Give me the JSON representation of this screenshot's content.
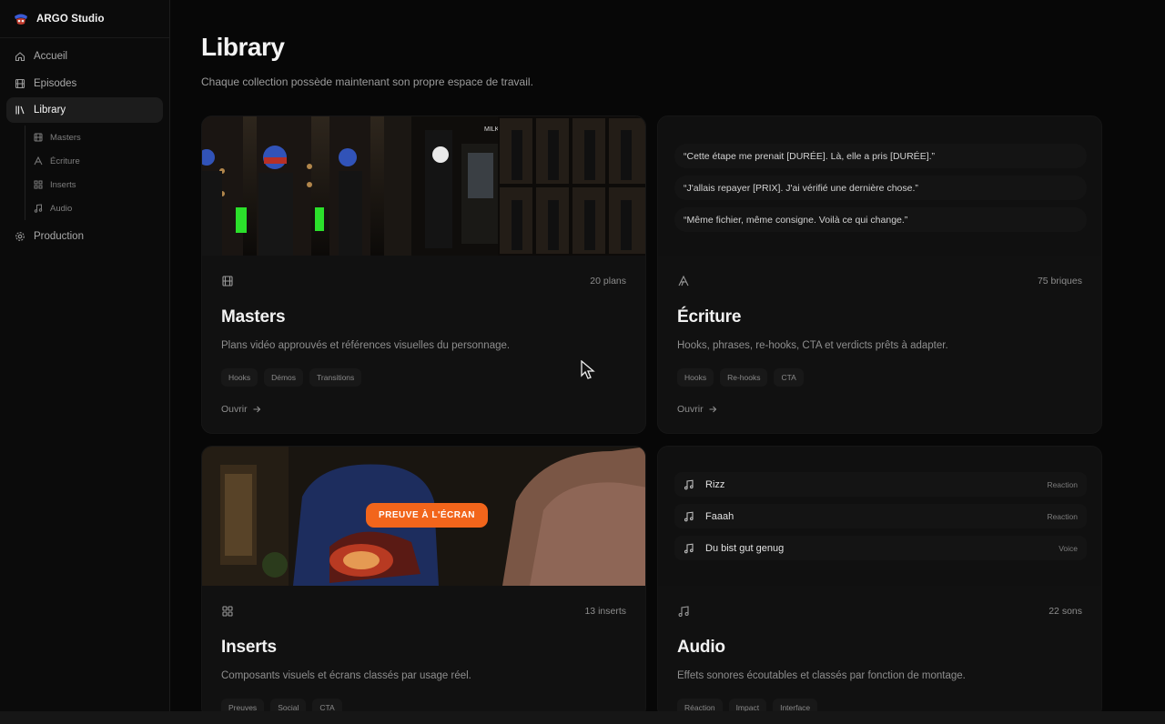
{
  "app": {
    "name": "ARGO Studio"
  },
  "sidebar": {
    "items": [
      {
        "label": "Accueil",
        "icon": "home-icon"
      },
      {
        "label": "Episodes",
        "icon": "film-icon"
      },
      {
        "label": "Library",
        "icon": "library-icon",
        "active": true
      },
      {
        "label": "Production",
        "icon": "gear-icon"
      }
    ],
    "sub_items": [
      {
        "label": "Masters",
        "icon": "film-icon"
      },
      {
        "label": "Écriture",
        "icon": "text-icon"
      },
      {
        "label": "Inserts",
        "icon": "grid-icon"
      },
      {
        "label": "Audio",
        "icon": "music-icon"
      }
    ]
  },
  "page": {
    "title": "Library",
    "subtitle": "Chaque collection possède maintenant son propre espace de travail."
  },
  "cards": {
    "masters": {
      "count": "20 plans",
      "title": "Masters",
      "description": "Plans vidéo approuvés et références visuelles du personnage.",
      "tags": [
        "Hooks",
        "Démos",
        "Transitions"
      ],
      "open": "Ouvrir"
    },
    "ecriture": {
      "quotes": [
        "“Cette étape me prenait [DURÉE]. Là, elle a pris [DURÉE].”",
        "“J'allais repayer [PRIX]. J'ai vérifié une dernière chose.”",
        "“Même fichier, même consigne. Voilà ce qui change.”"
      ],
      "count": "75 briques",
      "title": "Écriture",
      "description": "Hooks, phrases, re-hooks, CTA et verdicts prêts à adapter.",
      "tags": [
        "Hooks",
        "Re-hooks",
        "CTA"
      ],
      "open": "Ouvrir"
    },
    "inserts": {
      "badge": "PREUVE À L'ÉCRAN",
      "count": "13 inserts",
      "title": "Inserts",
      "description": "Composants visuels et écrans classés par usage réel.",
      "tags": [
        "Preuves",
        "Social",
        "CTA"
      ]
    },
    "audio": {
      "tracks": [
        {
          "name": "Rizz",
          "kind": "Reaction"
        },
        {
          "name": "Faaah",
          "kind": "Reaction"
        },
        {
          "name": "Du bist gut genug",
          "kind": "Voice"
        }
      ],
      "count": "22 sons",
      "title": "Audio",
      "description": "Effets sonores écoutables et classés par fonction de montage.",
      "tags": [
        "Réaction",
        "Impact",
        "Interface"
      ]
    }
  },
  "colors": {
    "accent": "#f2651b",
    "background": "#070707",
    "card": "#111111"
  }
}
